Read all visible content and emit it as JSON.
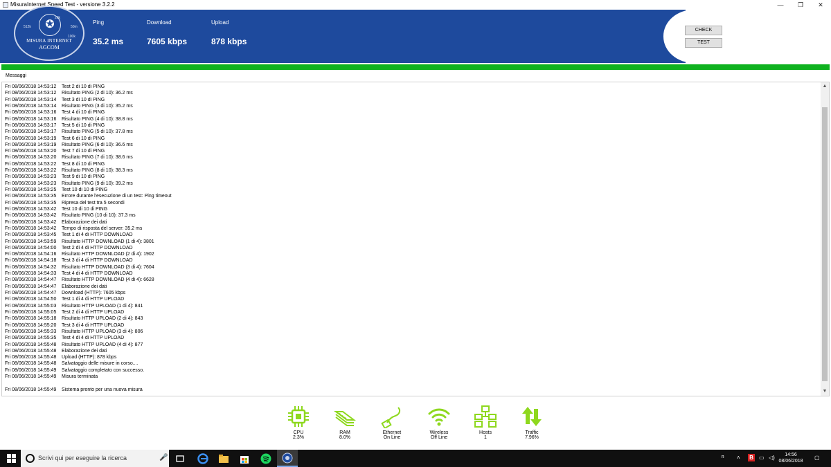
{
  "window": {
    "title": "MisuraInternet Speed Test - versione 3.2.2",
    "minimize": "—",
    "restore": "❐",
    "close": "✕"
  },
  "logo": {
    "line1": "MISURA INTERNET",
    "line2": "AGCOM",
    "ticks": [
      "20k",
      "50m",
      "512k",
      "100k"
    ]
  },
  "header": {
    "metrics": [
      {
        "label": "Ping",
        "value": "35.2 ms"
      },
      {
        "label": "Download",
        "value": "7605 kbps"
      },
      {
        "label": "Upload",
        "value": "878 kbps"
      }
    ],
    "check_label": "CHECK",
    "test_label": "TEST"
  },
  "progress": 1.0,
  "messages_label": "Messaggi",
  "log": [
    {
      "ts": "Fri 08/06/2018 14:53:12",
      "msg": "Test 2 di 10 di PING"
    },
    {
      "ts": "Fri 08/06/2018 14:53:12",
      "msg": "Risultato PING (2 di 10): 36.2 ms"
    },
    {
      "ts": "Fri 08/06/2018 14:53:14",
      "msg": "Test 3 di 10 di PING"
    },
    {
      "ts": "Fri 08/06/2018 14:53:14",
      "msg": "Risultato PING (3 di 10): 35.2 ms"
    },
    {
      "ts": "Fri 08/06/2018 14:53:16",
      "msg": "Test 4 di 10 di PING"
    },
    {
      "ts": "Fri 08/06/2018 14:53:16",
      "msg": "Risultato PING (4 di 10): 38.8 ms"
    },
    {
      "ts": "Fri 08/06/2018 14:53:17",
      "msg": "Test 5 di 10 di PING"
    },
    {
      "ts": "Fri 08/06/2018 14:53:17",
      "msg": "Risultato PING (5 di 10): 37.8 ms"
    },
    {
      "ts": "Fri 08/06/2018 14:53:19",
      "msg": "Test 6 di 10 di PING"
    },
    {
      "ts": "Fri 08/06/2018 14:53:19",
      "msg": "Risultato PING (6 di 10): 36.6 ms"
    },
    {
      "ts": "Fri 08/06/2018 14:53:20",
      "msg": "Test 7 di 10 di PING"
    },
    {
      "ts": "Fri 08/06/2018 14:53:20",
      "msg": "Risultato PING (7 di 10): 38.6 ms"
    },
    {
      "ts": "Fri 08/06/2018 14:53:22",
      "msg": "Test 8 di 10 di PING"
    },
    {
      "ts": "Fri 08/06/2018 14:53:22",
      "msg": "Risultato PING (8 di 10): 38.3 ms"
    },
    {
      "ts": "Fri 08/06/2018 14:53:23",
      "msg": "Test 9 di 10 di PING"
    },
    {
      "ts": "Fri 08/06/2018 14:53:23",
      "msg": "Risultato PING (9 di 10): 39.2 ms"
    },
    {
      "ts": "Fri 08/06/2018 14:53:25",
      "msg": "Test 10 di 10 di PING"
    },
    {
      "ts": "Fri 08/06/2018 14:53:35",
      "msg": "Errore durante l'esecuzione di un test: Ping timeout"
    },
    {
      "ts": "Fri 08/06/2018 14:53:35",
      "msg": "Ripresa del test tra 5 secondi"
    },
    {
      "ts": "Fri 08/06/2018 14:53:42",
      "msg": "Test 10 di 10 di PING"
    },
    {
      "ts": "Fri 08/06/2018 14:53:42",
      "msg": "Risultato PING (10 di 10): 37.3 ms"
    },
    {
      "ts": "Fri 08/06/2018 14:53:42",
      "msg": "Elaborazione dei dati"
    },
    {
      "ts": "Fri 08/06/2018 14:53:42",
      "msg": "Tempo di risposta del server: 35.2 ms"
    },
    {
      "ts": "Fri 08/06/2018 14:53:45",
      "msg": "Test 1 di 4 di HTTP DOWNLOAD"
    },
    {
      "ts": "Fri 08/06/2018 14:53:59",
      "msg": "Risultato HTTP DOWNLOAD (1 di 4): 3801"
    },
    {
      "ts": "Fri 08/06/2018 14:54:00",
      "msg": "Test 2 di 4 di HTTP DOWNLOAD"
    },
    {
      "ts": "Fri 08/06/2018 14:54:16",
      "msg": "Risultato HTTP DOWNLOAD (2 di 4): 1902"
    },
    {
      "ts": "Fri 08/06/2018 14:54:18",
      "msg": "Test 3 di 4 di HTTP DOWNLOAD"
    },
    {
      "ts": "Fri 08/06/2018 14:54:32",
      "msg": "Risultato HTTP DOWNLOAD (3 di 4): 7604"
    },
    {
      "ts": "Fri 08/06/2018 14:54:33",
      "msg": "Test 4 di 4 di HTTP DOWNLOAD"
    },
    {
      "ts": "Fri 08/06/2018 14:54:47",
      "msg": "Risultato HTTP DOWNLOAD (4 di 4): 6628"
    },
    {
      "ts": "Fri 08/06/2018 14:54:47",
      "msg": "Elaborazione dei dati"
    },
    {
      "ts": "Fri 08/06/2018 14:54:47",
      "msg": "Download (HTTP): 7605 kbps"
    },
    {
      "ts": "Fri 08/06/2018 14:54:50",
      "msg": "Test 1 di 4 di HTTP UPLOAD"
    },
    {
      "ts": "Fri 08/06/2018 14:55:03",
      "msg": "Risultato HTTP UPLOAD (1 di 4): 841"
    },
    {
      "ts": "Fri 08/06/2018 14:55:05",
      "msg": "Test 2 di 4 di HTTP UPLOAD"
    },
    {
      "ts": "Fri 08/06/2018 14:55:18",
      "msg": "Risultato HTTP UPLOAD (2 di 4): 843"
    },
    {
      "ts": "Fri 08/06/2018 14:55:20",
      "msg": "Test 3 di 4 di HTTP UPLOAD"
    },
    {
      "ts": "Fri 08/06/2018 14:55:33",
      "msg": "Risultato HTTP UPLOAD (3 di 4): 806"
    },
    {
      "ts": "Fri 08/06/2018 14:55:35",
      "msg": "Test 4 di 4 di HTTP UPLOAD"
    },
    {
      "ts": "Fri 08/06/2018 14:55:48",
      "msg": "Risultato HTTP UPLOAD (4 di 4): 877"
    },
    {
      "ts": "Fri 08/06/2018 14:55:48",
      "msg": "Elaborazione dei dati"
    },
    {
      "ts": "Fri 08/06/2018 14:55:48",
      "msg": "Upload (HTTP): 878 kbps"
    },
    {
      "ts": "Fri 08/06/2018 14:55:48",
      "msg": "Salvataggio delle misure in corso...."
    },
    {
      "ts": "Fri 08/06/2018 14:55:49",
      "msg": "Salvataggio completato con successo."
    },
    {
      "ts": "Fri 08/06/2018 14:55:49",
      "msg": "Misura terminata"
    },
    {
      "ts": "",
      "msg": ""
    },
    {
      "ts": "Fri 08/06/2018 14:55:49",
      "msg": "Sistema pronto per una nuova misura"
    }
  ],
  "status": [
    {
      "id": "cpu",
      "icon": "cpu-icon",
      "name": "CPU",
      "value": "2.3%"
    },
    {
      "id": "ram",
      "icon": "ram-icon",
      "name": "RAM",
      "value": "8.0%"
    },
    {
      "id": "ethernet",
      "icon": "ethernet-icon",
      "name": "Ethernet",
      "value": "On Line"
    },
    {
      "id": "wireless",
      "icon": "wifi-icon",
      "name": "Wireless",
      "value": "Off Line"
    },
    {
      "id": "hosts",
      "icon": "hosts-icon",
      "name": "Hosts",
      "value": "1"
    },
    {
      "id": "traffic",
      "icon": "traffic-icon",
      "name": "Traffic",
      "value": "7.96%"
    }
  ],
  "colors": {
    "header_blue": "#1e4a9d",
    "progress_green": "#0fb21f",
    "status_green": "#8ed81e"
  },
  "taskbar": {
    "search_placeholder": "Scrivi qui per eseguire la ricerca",
    "time": "14:56",
    "date": "08/06/2018"
  }
}
